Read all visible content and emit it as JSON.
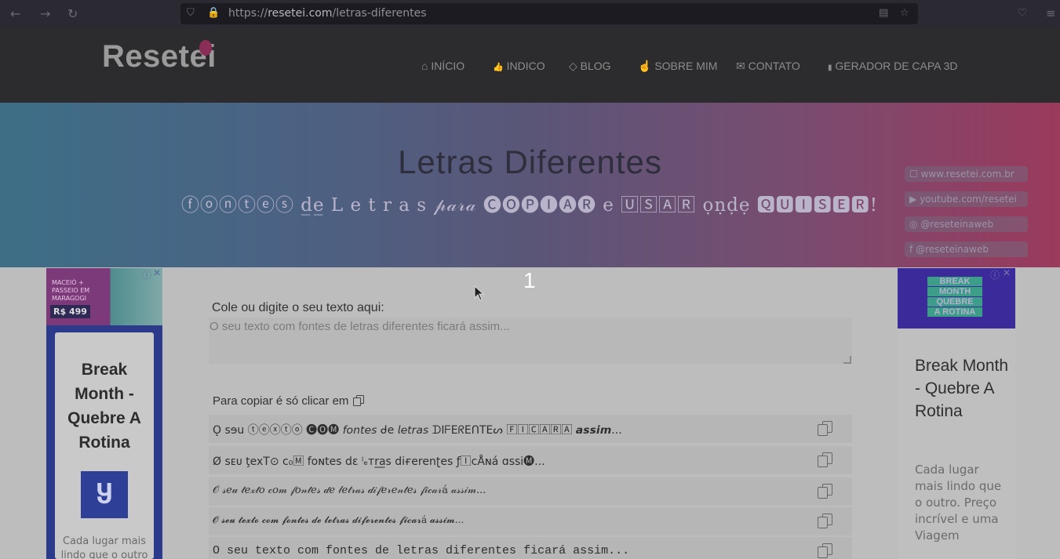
{
  "browser": {
    "url_prefix": "https://",
    "url_domain": "resetei.com",
    "url_path": "/letras-diferentes"
  },
  "site": {
    "logo": "Resetei",
    "menu": [
      {
        "icon": "home-icon",
        "glyph": "⌂",
        "label": "INÍCIO"
      },
      {
        "icon": "thumbs-up-icon",
        "glyph": "👍",
        "label": "INDICO"
      },
      {
        "icon": "diamond-icon",
        "glyph": "◇",
        "label": "BLOG"
      },
      {
        "icon": "hand-pointer-icon",
        "glyph": "☝",
        "label": "SOBRE MIM"
      },
      {
        "icon": "envelope-icon",
        "glyph": "✉",
        "label": "CONTATO"
      },
      {
        "icon": "book-icon",
        "glyph": "▮",
        "label": "GERADOR DE CAPA 3D"
      }
    ]
  },
  "hero": {
    "title": "Letras Diferentes",
    "subtitle": "ⓕⓞⓝⓣⓔⓢ d̲e̲ L e t r a s 𝓅𝒶𝓇𝒶 🅒🅞🅟🅘🅐🅡 e 🅄🅂🄰🅁 ọṇḍẹ 🆀🆄🅸🆂🅴🆁!",
    "social": [
      {
        "icon": "chat-icon",
        "glyph": "☐",
        "label": "www.resetei.com.br"
      },
      {
        "icon": "youtube-icon",
        "glyph": "▶",
        "label": "youtube.com/resetei"
      },
      {
        "icon": "instagram-icon",
        "glyph": "◎",
        "label": "@reseteinaweb"
      },
      {
        "icon": "facebook-icon",
        "glyph": "f",
        "label": "@reseteinaweb"
      }
    ]
  },
  "counter": "1",
  "tool": {
    "input_label": "Cole ou digite o seu texto aqui:",
    "input_placeholder": "O seu texto com fontes de letras diferentes ficará assim...",
    "copy_hint": "Para copiar é só clicar em",
    "results": [
      "Ǫ sɘu ⓣⓔⓧⓣⓞ 🅒🅞🅜 𝘧𝘰𝘯𝘵𝘦𝘴 ᑯe 𝘭𝘦𝘵𝘳𝘢𝘴 ᗪIᖴEᖇEᑎTEᔕ 🄵🄸🄲🄰🅁🄰 𝙖𝙨𝙨𝙞𝙢...",
      "Ø ꜱᴇᴜ ţexT⊙ c₀🄼 foɴtes dɛ ˡₑᴛr̲a̲s diғerenʈes ƒ🄸cÅɴá ɑssi🅜...",
      "𝒪 𝓈𝑒𝓊 𝓉𝑒𝓍𝓉𝑜 𝒸𝑜𝓂 𝒻𝑜𝓃𝓉𝑒𝓈 𝒹𝑒 𝓁𝑒𝓉𝓇𝒶𝓈 𝒹𝒾𝒻𝑒𝓇𝑒𝓃𝓉𝑒𝓈 𝒻𝒾𝒸𝒶𝓇á 𝒶𝓈𝓈𝒾𝓂...",
      "𝓞 𝓼𝓮𝓾 𝓽𝓮𝔁𝓽𝓸 𝓬𝓸𝓶 𝓯𝓸𝓷𝓽𝓮𝓼 𝓭𝓮 𝓵𝓮𝓽𝓻𝓪𝓼 𝓭𝓲𝓯𝓮𝓻𝓮𝓷𝓽𝓮𝓼 𝓯𝓲𝓬𝓪𝓻á 𝓪𝓼𝓼𝓲𝓶...",
      "O seu texto com fontes de letras diferentes ficará assim..."
    ]
  },
  "ads": {
    "left": {
      "banner_text": "MACEIÓ + PASSEIO EM MARAGOGI",
      "banner_price": "R$ 499",
      "title": "Break Month - Quebre A Rotina",
      "logo_glyph": "Ⴘ",
      "desc": "Cada lugar mais lindo que o outro"
    },
    "right": {
      "banner_lines": [
        "BREAK",
        "MONTH",
        "QUEBRE",
        "A ROTINA"
      ],
      "title": "Break Month - Quebre A Rotina",
      "desc": "Cada lugar mais lindo que o outro. Preço incrível e uma Viagem"
    }
  }
}
